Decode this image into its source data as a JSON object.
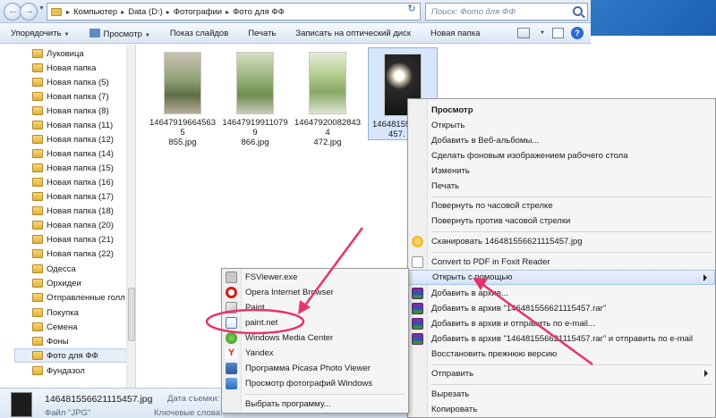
{
  "address": {
    "crumbs": [
      "Компьютер",
      "Data (D:)",
      "Фотографии",
      "Фото для ФФ"
    ],
    "search_placeholder": "Поиск: Фото для ФФ"
  },
  "toolbar": {
    "organize": "Упорядочить",
    "preview": "Просмотр",
    "slideshow": "Показ слайдов",
    "print": "Печать",
    "burn": "Записать на оптический диск",
    "new_folder": "Новая папка"
  },
  "navpane": {
    "items": [
      "Луковица",
      "Новая папка",
      "Новая папка (5)",
      "Новая папка (7)",
      "Новая папка (8)",
      "Новая папка (11)",
      "Новая папка (12)",
      "Новая папка (14)",
      "Новая папка (15)",
      "Новая папка (16)",
      "Новая папка (17)",
      "Новая папка (18)",
      "Новая папка (20)",
      "Новая папка (21)",
      "Новая папка (22)",
      "Одесса",
      "Орхидеи",
      "Отправленные голл",
      "Покупка",
      "Семена",
      "Фоны",
      "Фото для ФФ",
      "Фундазол"
    ]
  },
  "files": [
    {
      "line1": "146479196645635",
      "line2": "855.jpg"
    },
    {
      "line1": "146479199110799",
      "line2": "866.jpg"
    },
    {
      "line1": "146479200828434",
      "line2": "472.jpg"
    },
    {
      "line1": "14648155",
      "line2": "457."
    }
  ],
  "details": {
    "filename": "146481556621115457.jpg",
    "filetype": "Файл \"JPG\"",
    "date_label": "Дата съемки:",
    "keywords_label": "Ключевые слова:"
  },
  "context_menu": {
    "preview": "Просмотр",
    "open": "Открыть",
    "add_web_album": "Добавить в Веб-альбомы...",
    "set_wallpaper": "Сделать фоновым изображением рабочего стола",
    "edit": "Изменить",
    "print": "Печать",
    "rotate_cw": "Повернуть по часовой стрелке",
    "rotate_ccw": "Повернуть против часовой стрелки",
    "scan": "Сканировать 146481556621115457.jpg",
    "foxit": "Convert to PDF in Foxit Reader",
    "open_with": "Открыть с помощью",
    "add_archive": "Добавить в архив...",
    "add_archive_rar": "Добавить в архив \"146481556621115457.rar\"",
    "add_archive_email": "Добавить в архив и отправить по e-mail...",
    "add_archive_rar_email": "Добавить в архив \"146481556621115457.rar\" и отправить по e-mail",
    "restore": "Восстановить прежнюю версию",
    "send_to": "Отправить",
    "cut": "Вырезать",
    "copy": "Копировать"
  },
  "open_with_menu": {
    "fsviewer": "FSViewer.exe",
    "opera": "Opera Internet Browser",
    "paint": "Paint",
    "paintnet": "paint.net",
    "wmc": "Windows Media Center",
    "yandex": "Yandex",
    "picasa": "Программа Picasa Photo Viewer",
    "win_viewer": "Просмотр фотографий Windows",
    "choose": "Выбрать программу..."
  },
  "colors": {
    "annotation": "#e8336a",
    "desktop": "#2f79c8",
    "highlight": "#d6e4f6"
  }
}
